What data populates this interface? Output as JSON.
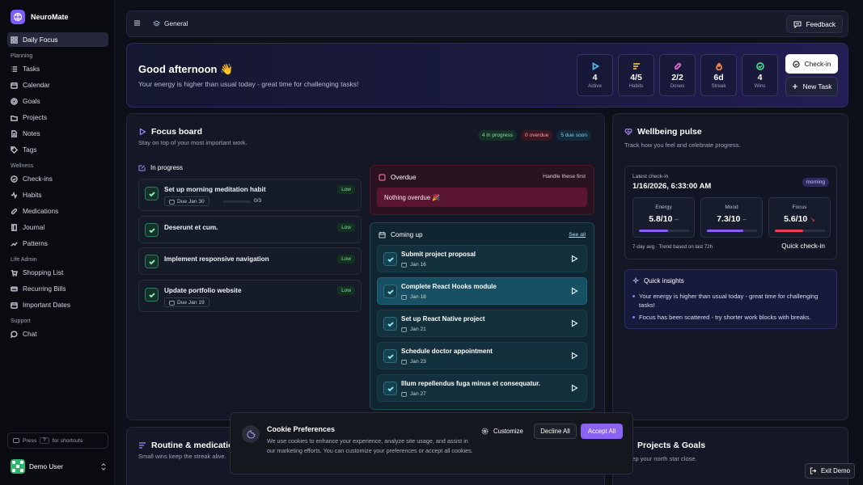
{
  "app": {
    "name": "NeuroMate"
  },
  "sidebar": {
    "top_item": {
      "label": "Daily Focus",
      "icon": "grid-icon"
    },
    "groups": [
      {
        "title": "Planning",
        "items": [
          {
            "label": "Tasks",
            "icon": "list-icon"
          },
          {
            "label": "Calendar",
            "icon": "calendar-icon"
          },
          {
            "label": "Goals",
            "icon": "target-icon"
          },
          {
            "label": "Projects",
            "icon": "folder-icon"
          },
          {
            "label": "Notes",
            "icon": "note-icon"
          },
          {
            "label": "Tags",
            "icon": "tag-icon"
          }
        ]
      },
      {
        "title": "Wellness",
        "items": [
          {
            "label": "Check-ins",
            "icon": "checkin-icon"
          },
          {
            "label": "Habits",
            "icon": "habit-icon"
          },
          {
            "label": "Medications",
            "icon": "pill-icon"
          },
          {
            "label": "Journal",
            "icon": "book-icon"
          },
          {
            "label": "Patterns",
            "icon": "trend-icon"
          }
        ]
      },
      {
        "title": "Life Admin",
        "items": [
          {
            "label": "Shopping List",
            "icon": "cart-icon"
          },
          {
            "label": "Recurring Bills",
            "icon": "bill-icon"
          },
          {
            "label": "Important Dates",
            "icon": "calendar-icon"
          }
        ]
      },
      {
        "title": "Support",
        "items": [
          {
            "label": "Chat",
            "icon": "chat-icon"
          }
        ]
      }
    ],
    "shortcuts": {
      "press": "Press",
      "key": "?",
      "suffix": "for shortcuts"
    },
    "user": {
      "name": "Demo User"
    }
  },
  "topbar": {
    "crumb": "General",
    "feedback": "Feedback"
  },
  "hero": {
    "greeting": "Good afternoon",
    "emoji": "👋",
    "subtitle": "Your energy is higher than usual today - great time for challenging tasks!",
    "stats": [
      {
        "value": "4",
        "label": "Active",
        "icon": "play-icon",
        "color": "#4fb8e8"
      },
      {
        "value": "4/5",
        "label": "Habits",
        "icon": "habits-icon",
        "color": "#f2b233"
      },
      {
        "value": "2/2",
        "label": "Doses",
        "icon": "pill-icon",
        "color": "#e86bd0"
      },
      {
        "value": "6d",
        "label": "Streak",
        "icon": "flame-icon",
        "color": "#f28a3a"
      },
      {
        "value": "4",
        "label": "Wins",
        "icon": "check-circle-icon",
        "color": "#48d18a"
      }
    ],
    "checkin_label": "Check-in",
    "newtask_label": "New Task"
  },
  "focus": {
    "title": "Focus board",
    "subtitle": "Stay on top of your most important work.",
    "chips": {
      "in_progress": "4 in progress",
      "overdue": "0 overdue",
      "due_soon": "5 due soon"
    },
    "in_progress_label": "In progress",
    "tasks": [
      {
        "title": "Set up morning meditation habit",
        "priority": "Low",
        "due": "Due Jan 30",
        "progress_text": "0/3",
        "progress": 0
      },
      {
        "title": "Deserunt et cum.",
        "priority": "Low"
      },
      {
        "title": "Implement responsive navigation",
        "priority": "Low"
      },
      {
        "title": "Update portfolio website",
        "priority": "Low",
        "due": "Due Jan 19"
      }
    ],
    "overdue": {
      "title": "Overdue",
      "hint": "Handle these first",
      "empty": "Nothing overdue 🎉"
    },
    "coming": {
      "title": "Coming up",
      "see_all": "See all",
      "items": [
        {
          "title": "Submit project proposal",
          "date": "Jan 16"
        },
        {
          "title": "Complete React Hooks module",
          "date": "Jan 18"
        },
        {
          "title": "Set up React Native project",
          "date": "Jan 21"
        },
        {
          "title": "Schedule doctor appointment",
          "date": "Jan 23"
        },
        {
          "title": "Illum repellendus fuga minus et consequatur.",
          "date": "Jan 27"
        }
      ]
    }
  },
  "wellbeing": {
    "title": "Wellbeing pulse",
    "subtitle": "Track how you feel and celebrate progress.",
    "latest_label": "Latest check-in",
    "latest_value": "1/16/2026, 6:33:00 AM",
    "badge": "morning",
    "metrics": [
      {
        "label": "Energy",
        "value": "5.8/10",
        "trend": "–",
        "level": 0.58,
        "color": "#8b5cf6"
      },
      {
        "label": "Mood",
        "value": "7.3/10",
        "trend": "–",
        "level": 0.73,
        "color": "#8b5cf6"
      },
      {
        "label": "Focus",
        "value": "5.6/10",
        "trend": "↘",
        "level": 0.56,
        "color": "#ef3e5a"
      }
    ],
    "avg_text": "7-day avg · Trend based on last 72h",
    "quick_checkin": "Quick check-in",
    "insights_title": "Quick insights",
    "insights": [
      "Your energy is higher than usual today - great time for challenging tasks!",
      "Focus has been scattered - try shorter work blocks with breaks."
    ]
  },
  "routine": {
    "title": "Routine & medication",
    "subtitle": "Small wins keep the streak alive."
  },
  "projects": {
    "title": "Projects & Goals",
    "subtitle": "Keep your north star close."
  },
  "cookie": {
    "title": "Cookie Preferences",
    "text": "We use cookies to enhance your experience, analyze site usage, and assist in our marketing efforts. You can customize your preferences or accept all cookies.",
    "customize": "Customize",
    "decline": "Decline All",
    "accept": "Accept All"
  },
  "exit_demo": "Exit Demo"
}
